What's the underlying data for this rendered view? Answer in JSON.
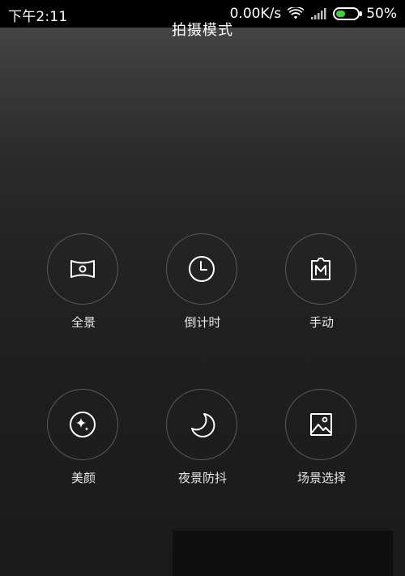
{
  "status_bar": {
    "time": "下午2:11",
    "net_speed": "0.00K/s",
    "battery_percent": "50%",
    "battery_level": 0.5,
    "battery_color": "#3fd23f",
    "icons": [
      "wifi-icon",
      "signal-icon",
      "battery-icon"
    ]
  },
  "title": "拍摄模式",
  "modes": [
    {
      "label": "全景",
      "icon": "panorama-icon"
    },
    {
      "label": "倒计时",
      "icon": "clock-icon"
    },
    {
      "label": "手动",
      "icon": "manual-icon"
    },
    {
      "label": "美颜",
      "icon": "beauty-icon"
    },
    {
      "label": "夜景防抖",
      "icon": "moon-icon"
    },
    {
      "label": "场景选择",
      "icon": "scene-icon"
    }
  ]
}
